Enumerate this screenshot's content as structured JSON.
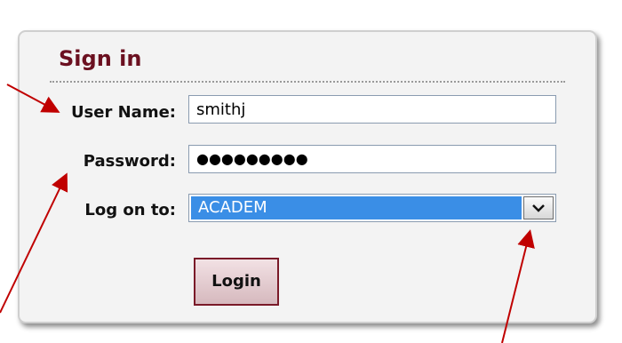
{
  "signin": {
    "title": "Sign in",
    "username_label": "User Name:",
    "username_value": "smithj",
    "password_label": "Password:",
    "password_value": "●●●●●●●●●",
    "logon_label": "Log on to:",
    "logon_value": "ACADEM",
    "login_button": "Login"
  },
  "colors": {
    "title": "#6b1020",
    "select_highlight": "#3a8ee6",
    "arrow": "#c00000"
  }
}
